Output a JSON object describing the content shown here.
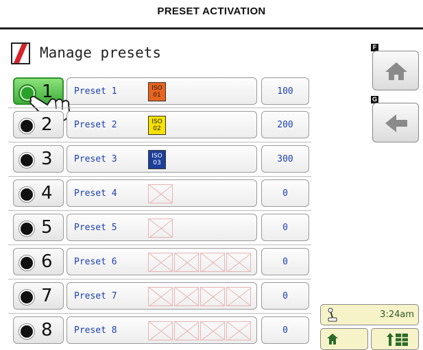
{
  "page": {
    "title": "PRESET ACTIVATION"
  },
  "header": {
    "title": "Manage presets",
    "icon": "red-slash-logo-icon"
  },
  "presets": [
    {
      "number": "1",
      "name": "Preset 1",
      "iso": [
        "ISO",
        "01"
      ],
      "iso_color": "#e8641e",
      "value": "100",
      "active": true
    },
    {
      "number": "2",
      "name": "Preset 2",
      "iso": [
        "ISO",
        "02"
      ],
      "iso_color": "#f6e100",
      "value": "200",
      "active": false
    },
    {
      "number": "3",
      "name": "Preset 3",
      "iso": [
        "ISO",
        "03"
      ],
      "iso_color": "#1d3f9a",
      "value": "300",
      "active": false
    },
    {
      "number": "4",
      "name": "Preset 4",
      "value": "0",
      "active": false
    },
    {
      "number": "5",
      "name": "Preset 5",
      "value": "0",
      "active": false
    },
    {
      "number": "6",
      "name": "Preset 6",
      "value": "0",
      "active": false
    },
    {
      "number": "7",
      "name": "Preset 7",
      "value": "0",
      "active": false
    },
    {
      "number": "8",
      "name": "Preset 8",
      "value": "0",
      "active": false
    }
  ],
  "softkeys": {
    "home": {
      "label": "F",
      "icon": "home-icon"
    },
    "back": {
      "label": "G",
      "icon": "back-arrow-icon"
    }
  },
  "status": {
    "time": "3:24am",
    "icon": "joystick-icon"
  },
  "bottom_buttons": [
    {
      "icon": "home-icon"
    },
    {
      "icon": "up-arrow-grid-icon"
    }
  ],
  "colors": {
    "active_green": "#3fae3a",
    "text_blue": "#1a3fb0",
    "status_bg": "#f7f3c8"
  }
}
